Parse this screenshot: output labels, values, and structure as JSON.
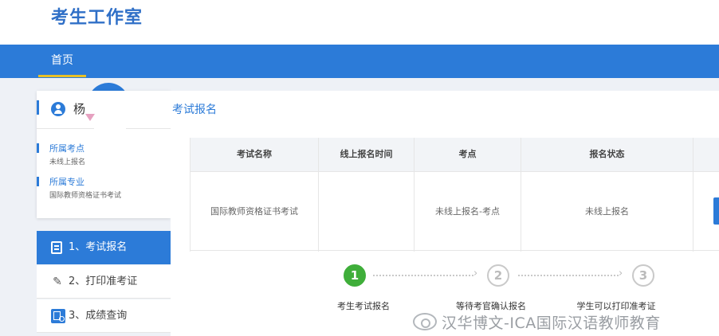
{
  "app": {
    "title": "考生工作室"
  },
  "nav": {
    "items": [
      {
        "label": "首页"
      }
    ]
  },
  "user": {
    "name": "杨",
    "exam_site_label": "所属考点",
    "exam_site_value": "未线上报名",
    "major_label": "所属专业",
    "major_value": "国际教师资格证书考试"
  },
  "menu": {
    "items": [
      {
        "label": "1、考试报名",
        "icon": "document-icon",
        "active": true
      },
      {
        "label": "2、打印准考证",
        "icon": "pencil-icon",
        "active": false
      },
      {
        "label": "3、成绩查询",
        "icon": "query-icon",
        "active": false
      }
    ]
  },
  "main": {
    "section_title": "考试报名",
    "table": {
      "headers": [
        "考试名称",
        "线上报名时间",
        "考点",
        "报名状态"
      ],
      "rows": [
        [
          "国际教师资格证书考试",
          "",
          "未线上报名-考点",
          "未线上报名"
        ]
      ]
    },
    "steps": [
      {
        "number": "1",
        "label": "考生考试报名",
        "status": "done"
      },
      {
        "number": "2",
        "label": "等待考官确认报名",
        "status": "todo"
      },
      {
        "number": "3",
        "label": "学生可以打印准考证",
        "status": "todo"
      }
    ]
  },
  "watermark": {
    "text": "汉华博文-ICA国际汉语教师教育"
  },
  "colors": {
    "primary": "#2c7bd8",
    "accent_underline": "#e8c026",
    "success": "#3fae3a"
  }
}
